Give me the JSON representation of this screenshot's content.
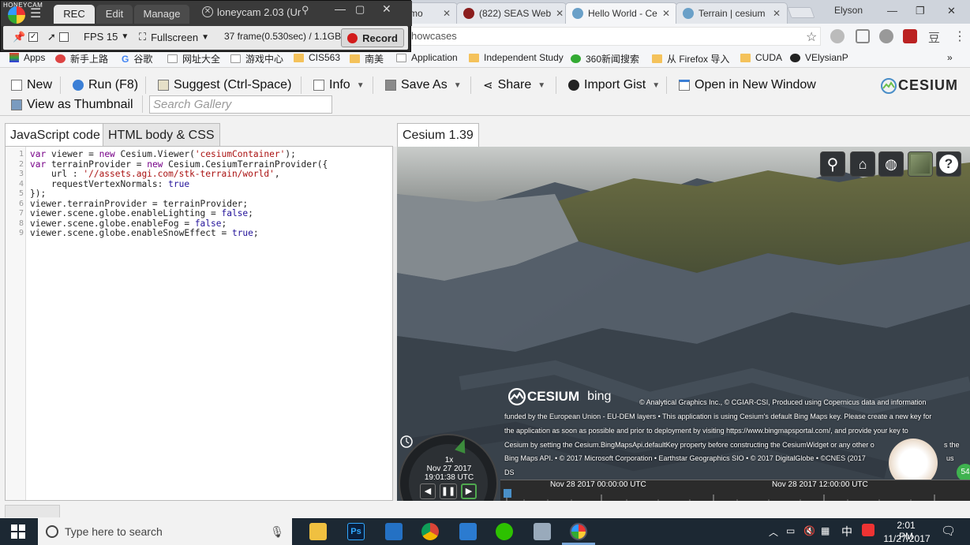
{
  "browser": {
    "tabs": [
      {
        "label": "mo",
        "active": false
      },
      {
        "label": "(822) SEAS Web",
        "active": false
      },
      {
        "label": "Hello World - Ce",
        "active": true
      },
      {
        "label": "Terrain | cesium",
        "active": false
      }
    ],
    "user": "Elyson",
    "address": "howcases",
    "bookmarks": [
      {
        "label": "Apps"
      },
      {
        "label": "新手上路"
      },
      {
        "label": "谷歌"
      },
      {
        "label": "网址大全"
      },
      {
        "label": "游戏中心"
      },
      {
        "label": "CIS563"
      },
      {
        "label": "南美"
      },
      {
        "label": "Application"
      },
      {
        "label": "Independent Study"
      },
      {
        "label": "360新闻搜索"
      },
      {
        "label": "从 Firefox 导入"
      },
      {
        "label": "CUDA"
      },
      {
        "label": "VElysianP"
      }
    ],
    "bookmarks_more": "»"
  },
  "honeycam": {
    "app_title": "HONEYCAM",
    "tabs": [
      "REC",
      "Edit",
      "Manage"
    ],
    "window_title": "loneycam 2.03 (Ur",
    "fps_label": "FPS 15",
    "fullscreen_label": "Fullscreen",
    "frame_info": "37 frame(0.530sec) / 1.1GB",
    "record_label": "Record"
  },
  "sandcastle": {
    "toolbar": {
      "new": "New",
      "run": "Run (F8)",
      "suggest": "Suggest (Ctrl-Space)",
      "info": "Info",
      "save_as": "Save As",
      "share": "Share",
      "import_gist": "Import Gist",
      "open_new_window": "Open in New Window",
      "view_thumbnail": "View as Thumbnail",
      "search_placeholder": "Search Gallery",
      "logo": "CESIUM"
    },
    "editor_tabs": [
      "JavaScript code",
      "HTML body & CSS"
    ],
    "viewer_tab": "Cesium 1.39",
    "code_lines": [
      "var viewer = new Cesium.Viewer('cesiumContainer');",
      "var terrainProvider = new Cesium.CesiumTerrainProvider({",
      "    url : '//assets.agi.com/stk-terrain/world',",
      "    requestVertexNormals: true",
      "});",
      "viewer.terrainProvider = terrainProvider;",
      "viewer.scene.globe.enableLighting = false;",
      "viewer.scene.globe.enableFog = false;",
      "viewer.scene.globe.enableSnowEffect = true;"
    ],
    "line_numbers": [
      "1",
      "2",
      "3",
      "4",
      "5",
      "6",
      "7",
      "8",
      "9"
    ]
  },
  "viewer": {
    "credit_logo": "CESIUM",
    "credit_bing": "bing",
    "credits": [
      "© Analytical Graphics Inc., © CGIAR-CSI, Produced using Copernicus data and information",
      "funded by the European Union - EU-DEM layers • This application is using Cesium's default Bing Maps key. Please create a new key for",
      "the application as soon as possible and prior to deployment by visiting https://www.bingmapsportal.com/, and provide your key to",
      "Cesium by setting the Cesium.BingMapsApi.defaultKey property before constructing the CesiumWidget or any other o",
      "Bing Maps API. • © 2017 Microsoft Corporation • Earthstar Geographics SIO • © 2017 DigitalGlobe • ©CNES (2017",
      "DS"
    ],
    "credit_right_fragments": [
      "s the",
      "us"
    ],
    "animation": {
      "speed": "1x",
      "date": "Nov 27 2017",
      "time": "19:01:38 UTC"
    },
    "timeline_labels": [
      "Nov 28 2017 00:00:00 UTC",
      "Nov 28 2017 12:00:00 UTC"
    ]
  },
  "taskbar": {
    "search_placeholder": "Type here to search",
    "ime": "中",
    "time": "2:01 PM",
    "date": "11/27/2017"
  },
  "colors": {
    "code_keyword": "#770088",
    "code_string": "#aa1111",
    "code_atom": "#221199",
    "record_red": "#d21b1b",
    "taskbar": "#1c2833"
  }
}
